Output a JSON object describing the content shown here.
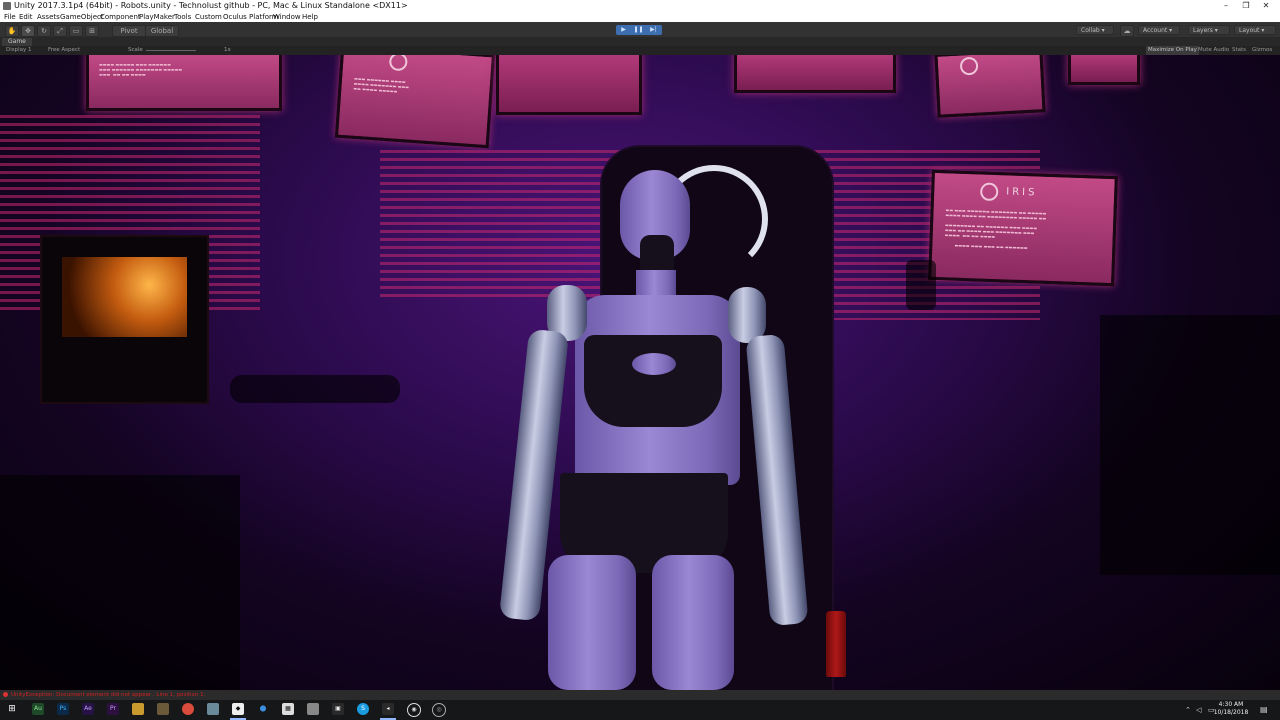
{
  "window": {
    "title": "Unity 2017.3.1p4 (64bit) - Robots.unity - Technolust github - PC, Mac & Linux Standalone <DX11>",
    "controls": [
      "–",
      "❐",
      "✕"
    ]
  },
  "menu": [
    "File",
    "Edit",
    "Assets",
    "GameObject",
    "Component",
    "PlayMaker",
    "Tools",
    "Custom",
    "Oculus Platform",
    "Window",
    "Help"
  ],
  "toolbar": {
    "pivot_label": "Pivot",
    "global_label": "Global",
    "collab_label": "Collab",
    "account_label": "Account",
    "layers_label": "Layers",
    "layout_label": "Layout"
  },
  "game_view": {
    "tab_label": "Game",
    "display": "Display 1",
    "aspect": "Free Aspect",
    "scale_label": "Scale",
    "scale_value": "1x",
    "maximize_on_play": "Maximize On Play",
    "mute_audio": "Mute Audio",
    "stats": "Stats",
    "gizmos": "Gizmos"
  },
  "scene": {
    "iris_label": "IRIS"
  },
  "status": {
    "message": "UnityException: Document element did not appear . Line 1, position 1."
  },
  "taskbar": {
    "time": "4:30 AM",
    "date": "10/18/2018",
    "apps": [
      "Au",
      "Ps",
      "Ae",
      "Pr"
    ]
  }
}
